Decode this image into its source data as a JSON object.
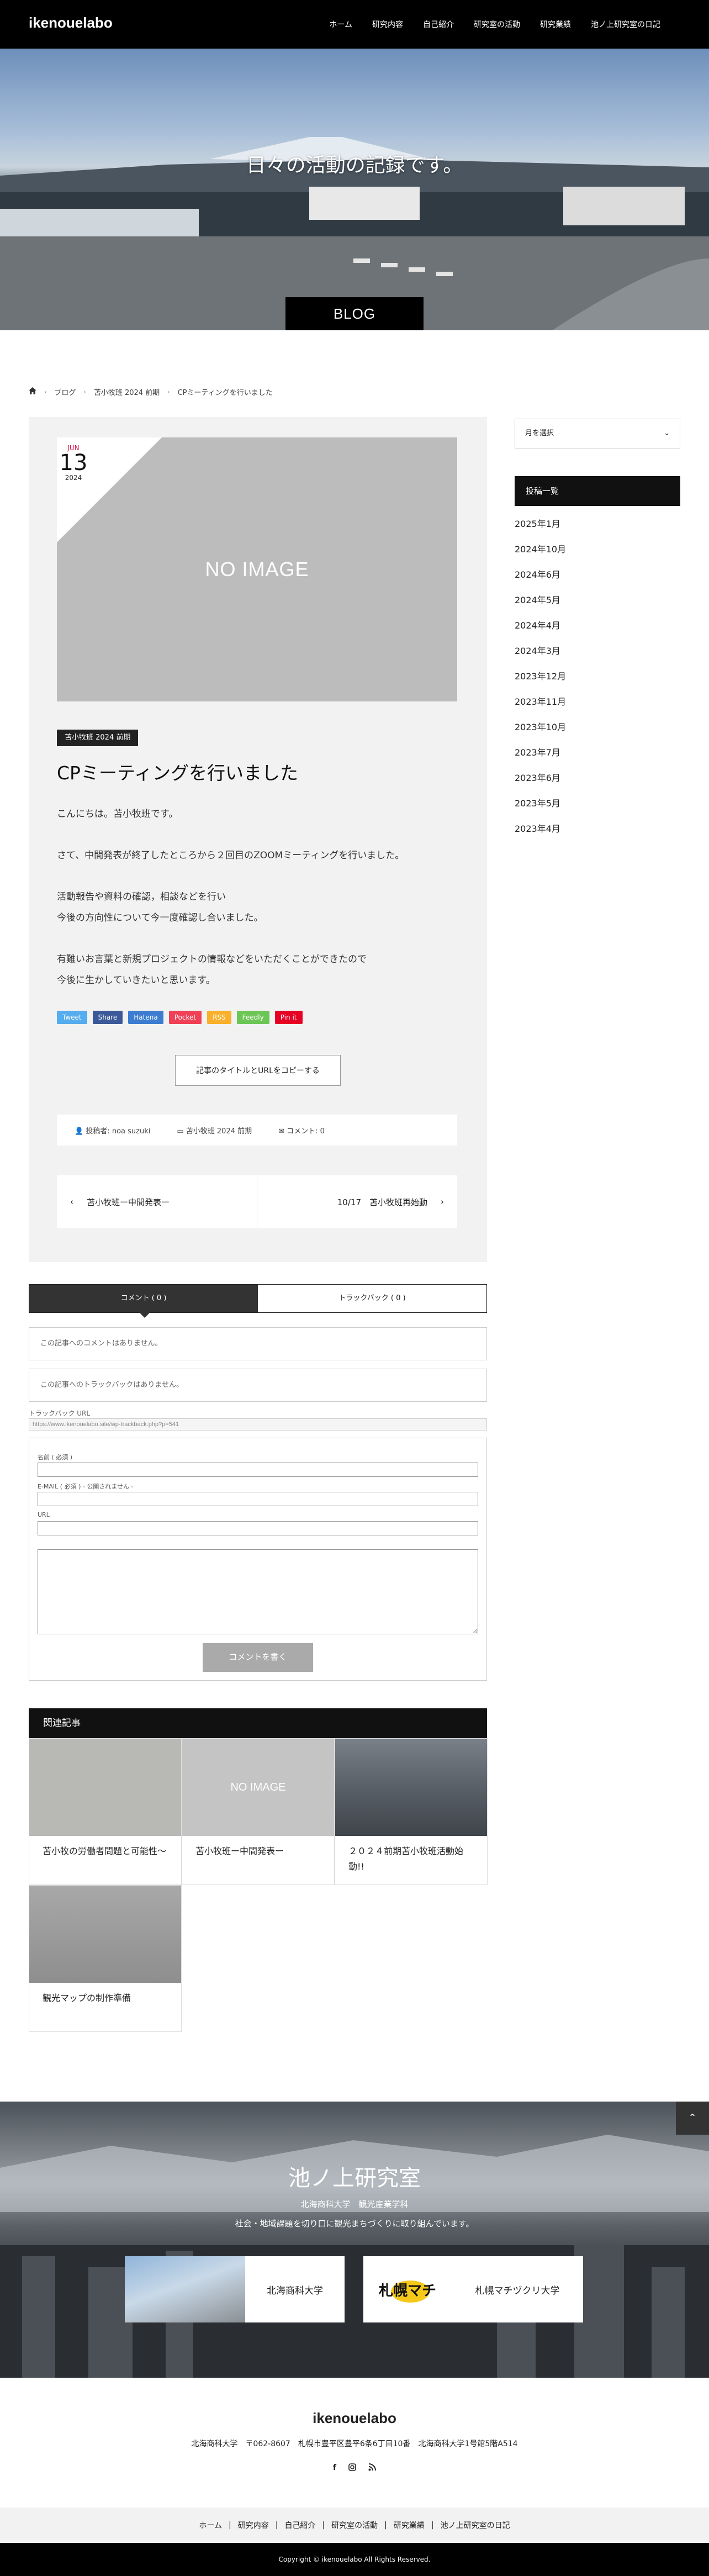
{
  "header": {
    "logo": "ikenouelabo",
    "nav": [
      "ホーム",
      "研究内容",
      "自己紹介",
      "研究室の活動",
      "研究業績",
      "池ノ上研究室の日記"
    ]
  },
  "hero": {
    "title": "日々の活動の記録です。",
    "badge": "BLOG"
  },
  "breadcrumb": {
    "items": [
      "ブログ",
      "苫小牧班 2024 前期",
      "CPミーティングを行いました"
    ]
  },
  "post": {
    "date_month": "JUN",
    "date_day": "13",
    "date_year": "2024",
    "no_image": "NO IMAGE",
    "category": "苫小牧班 2024 前期",
    "title": "CPミーティングを行いました",
    "paragraphs": [
      "こんにちは。苫小牧班です。",
      "さて、中間発表が終了したところから２回目のZOOMミーティングを行いました。",
      "活動報告や資料の確認，相談などを行い",
      "今後の方向性について今一度確認し合いました。",
      "有難いお言葉と新規プロジェクトの情報などをいただくことができたので",
      "今後に生かしていきたいと思います。"
    ],
    "share": [
      {
        "label": "Tweet",
        "color": "#55acee"
      },
      {
        "label": "Share",
        "color": "#3b5998"
      },
      {
        "label": "Hatena",
        "color": "#3c7dd1"
      },
      {
        "label": "Pocket",
        "color": "#ef4056"
      },
      {
        "label": "RSS",
        "color": "#f9b02a"
      },
      {
        "label": "Feedly",
        "color": "#6cc655"
      },
      {
        "label": "Pin it",
        "color": "#e60023"
      }
    ],
    "copy_button": "記事のタイトルとURLをコピーする",
    "meta_author": "投稿者: noa suzuki",
    "meta_category": "苫小牧班 2024 前期",
    "meta_comments": "コメント: 0",
    "prev": "苫小牧班ー中間発表ー",
    "next": "10/17　苫小牧班再始動"
  },
  "comments": {
    "tab_comments": "コメント ( 0 )",
    "tab_trackbacks": "トラックバック ( 0 )",
    "no_comments": "この記事へのコメントはありません。",
    "no_trackbacks": "この記事へのトラックバックはありません。",
    "trackback_label": "トラックバック URL",
    "trackback_url": "https://www.ikenouelabo.site/wp-trackback.php?p=541",
    "name_label": "名前 ( 必須 )",
    "email_label": "E-MAIL ( 必須 ) - 公開されません -",
    "url_label": "URL",
    "submit": "コメントを書く"
  },
  "related": {
    "heading": "関連記事",
    "items": [
      {
        "title": "苫小牧の労働者問題と可能性〜",
        "thumb_color": "#b8b8b4"
      },
      {
        "title": "苫小牧班ー中間発表ー",
        "thumb_color": "#c4c4c4",
        "no_image": "NO IMAGE"
      },
      {
        "title": "２０２４前期苫小牧班活動始動!!",
        "thumb_color": "#6b7078"
      },
      {
        "title": "観光マップの制作準備",
        "thumb_color": "#9a9a9a"
      }
    ]
  },
  "sidebar": {
    "archive_select": "月を選択",
    "heading": "投稿一覧",
    "months": [
      "2025年1月",
      "2024年10月",
      "2024年6月",
      "2024年5月",
      "2024年4月",
      "2024年3月",
      "2023年12月",
      "2023年11月",
      "2023年10月",
      "2023年7月",
      "2023年6月",
      "2023年5月",
      "2023年4月"
    ]
  },
  "footer_hero": {
    "title": "池ノ上研究室",
    "sub1": "北海商科大学　観光産業学科",
    "sub2": "社会・地域課題を切り口に観光まちづくりに取り組んでいます。",
    "banner1": "北海商科大学",
    "banner2": "札幌マチヅクリ大学",
    "banner2_logo": "札幌マチ"
  },
  "footer": {
    "logo": "ikenouelabo",
    "address": "北海商科大学　〒062-8607　札幌市豊平区豊平6条6丁目10番　北海商科大学1号館5階A514",
    "nav": [
      "ホーム",
      "研究内容",
      "自己紹介",
      "研究室の活動",
      "研究業績",
      "池ノ上研究室の日記"
    ],
    "copyright": "Copyright © ikenouelabo All Rights Reserved."
  }
}
